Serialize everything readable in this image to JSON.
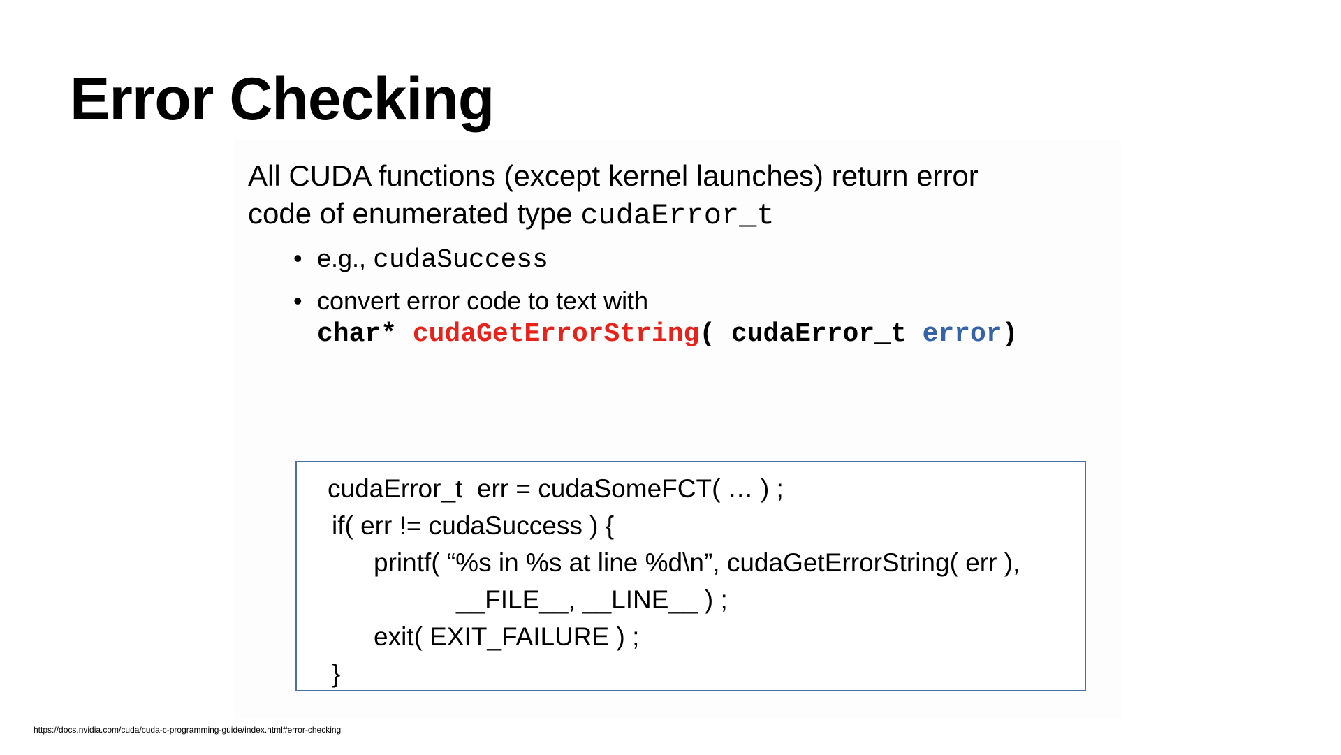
{
  "slide": {
    "title": "Error Checking",
    "intro": {
      "line1": "All CUDA functions (except kernel launches) return error",
      "line2_text": "code of enumerated type ",
      "line2_code": "cudaError_t"
    },
    "bullets": [
      {
        "marker": "•",
        "text": "e.g., ",
        "code": "cudaSuccess"
      },
      {
        "marker": "•",
        "text": "convert error code to text with",
        "signature": {
          "return_type": "char* ",
          "function_name": "cudaGetErrorString",
          "open_paren": "( cudaError_t ",
          "param_name": "error",
          "close_paren": ")"
        }
      }
    ],
    "code_example": {
      "lines": [
        "cudaError_t  err = cudaSomeFCT( … ) ;",
        "if( err != cudaSuccess ) {",
        "printf( “%s in %s at line %d\\n”, cudaGetErrorString( err ),",
        "__FILE__, __LINE__ ) ;",
        "exit( EXIT_FAILURE ) ;",
        "}"
      ]
    },
    "source_url": "https://docs.nvidia.com/cuda/cuda-c-programming-guide/index.html#error-checking",
    "colors": {
      "function_name": "#e8221b",
      "parameter": "#3463a8",
      "code_box_border": "#4b6fa5"
    }
  }
}
